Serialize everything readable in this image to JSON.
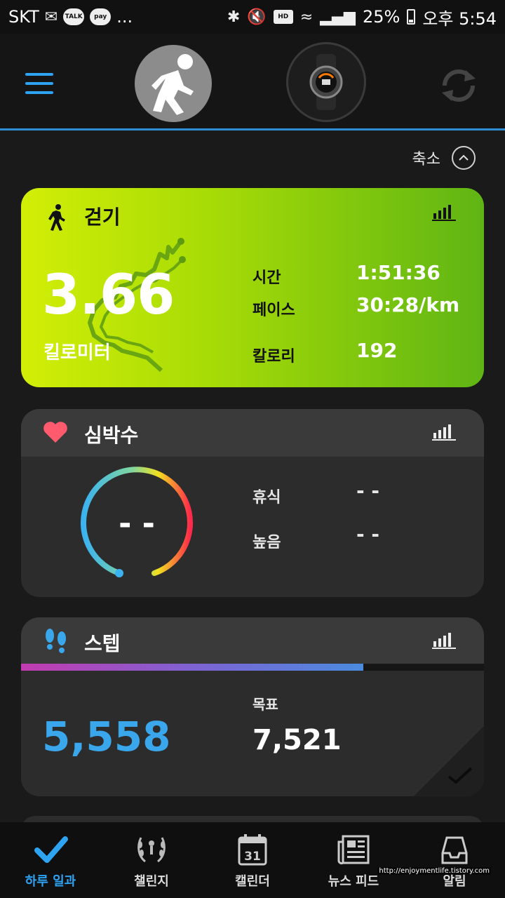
{
  "status_bar": {
    "carrier": "SKT",
    "talk_label": "TALK",
    "pay_label": "pay",
    "more": "...",
    "battery": "25%",
    "time": "오후 5:54",
    "hd_label": "HD"
  },
  "header": {
    "menu_icon": "hamburger-icon",
    "sync_icon": "sync-icon"
  },
  "collapse_label": "축소",
  "walk_card": {
    "title": "걷기",
    "distance": "3.66",
    "unit": "킬로미터",
    "stats": [
      {
        "label": "시간",
        "value": "1:51:36"
      },
      {
        "label": "페이스",
        "value": "30:28/km"
      },
      {
        "label": "칼로리",
        "value": "192"
      }
    ],
    "colors": {
      "gradient_start": "#d2ee06",
      "gradient_end": "#5fb514"
    }
  },
  "heart_card": {
    "title": "심박수",
    "current": "- -",
    "stats": [
      {
        "label": "휴식",
        "value": "- -"
      },
      {
        "label": "높음",
        "value": "- -"
      }
    ],
    "colors": {
      "heart": "#ff5a6e"
    }
  },
  "steps_card": {
    "title": "스텝",
    "steps": "5,558",
    "goal_label": "목표",
    "goal": "7,521",
    "progress_fraction": 0.739,
    "colors": {
      "steps": "#3aa6ec"
    }
  },
  "bottom_nav": [
    {
      "label": "하루 일과",
      "icon": "check-icon",
      "active": true
    },
    {
      "label": "챌린지",
      "icon": "laurel-icon",
      "active": false
    },
    {
      "label": "캘린더",
      "icon": "calendar-icon",
      "calendar_day": "31",
      "active": false
    },
    {
      "label": "뉴스 피드",
      "icon": "newspaper-icon",
      "active": false
    },
    {
      "label": "알림",
      "icon": "inbox-icon",
      "active": false
    }
  ],
  "watermark": "http://enjoymentlife.tistory.com",
  "accent_color": "#2ea3f2"
}
